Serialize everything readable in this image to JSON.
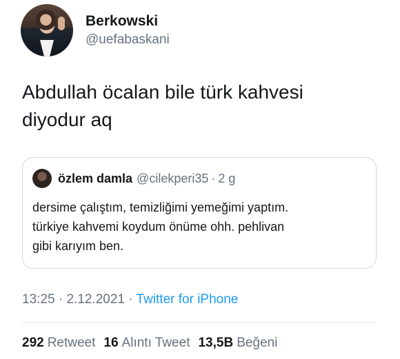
{
  "author": {
    "display_name": "Berkowski",
    "handle": "@uefabaskani"
  },
  "tweet": {
    "text_line_1": "Abdullah öcalan bile türk kahvesi",
    "text_line_2": "diyodur aq"
  },
  "quoted_tweet": {
    "display_name": "özlem damla",
    "handle": "@cilekperi35",
    "separator": "·",
    "time": "2 g",
    "text_line_1": "dersime çalıştım, temizliğimi yemeğimi yaptım.",
    "text_line_2": "türkiye kahvemi koydum önüme ohh. pehlivan",
    "text_line_3": "gibi karıyım ben."
  },
  "meta": {
    "time": "13:25",
    "separator_1": "·",
    "date": "2.12.2021",
    "separator_2": "·",
    "source": "Twitter for iPhone"
  },
  "stats": {
    "retweets_count": "292",
    "retweets_label": "Retweet",
    "quotes_count": "16",
    "quotes_label": "Alıntı Tweet",
    "likes_count": "13,5B",
    "likes_label": "Beğeni"
  },
  "colors": {
    "text_primary": "#14171a",
    "text_secondary": "#66717d",
    "link": "#1d9bf0",
    "border": "#cfd9de"
  }
}
